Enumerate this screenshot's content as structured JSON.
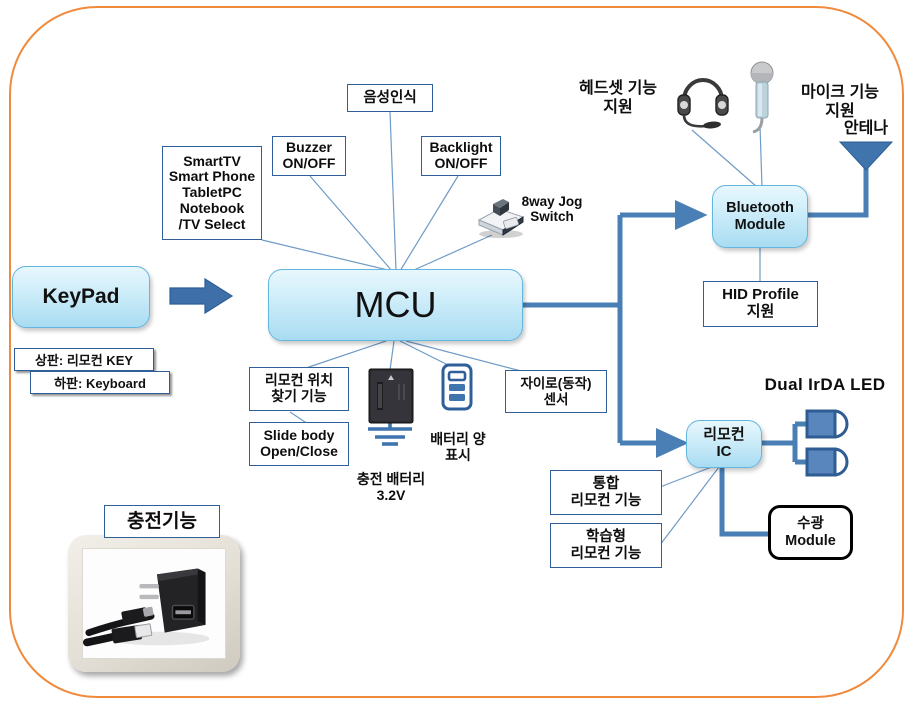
{
  "diagram": {
    "title": "Remote control / keypad system block diagram",
    "frame_color": "#f08a3c",
    "node_fill": "#bfe6f7",
    "connector_color": "#4a7fb5"
  },
  "nodes": {
    "keypad": "KeyPad",
    "mcu": "MCU",
    "bluetooth": "Bluetooth\nModule",
    "remote_ic": "리모컨\nIC",
    "receiver_module": "수광\nModule"
  },
  "keypad_labels": {
    "top": "상판: 리모컨 KEY",
    "bottom": "하판: Keyboard"
  },
  "mcu_inputs": [
    {
      "id": "device-select",
      "lines": [
        "SmartTV",
        "Smart Phone",
        "TabletPC",
        "Notebook",
        "/TV Select"
      ]
    },
    {
      "id": "buzzer",
      "lines": [
        "Buzzer",
        "ON/OFF"
      ]
    },
    {
      "id": "voice-recognition",
      "lines": [
        "음성인식"
      ]
    },
    {
      "id": "backlight",
      "lines": [
        "Backlight",
        "ON/OFF"
      ]
    }
  ],
  "mcu_outputs": [
    {
      "id": "remote-finder",
      "lines": [
        "리모컨 위치",
        "찾기 기능"
      ]
    },
    {
      "id": "slide-body",
      "lines": [
        "Slide body",
        "Open/Close"
      ]
    },
    {
      "id": "gyro-sensor",
      "lines": [
        "자이로(동작)",
        "센서"
      ]
    }
  ],
  "remote_ic_features": [
    {
      "id": "integrated-remote",
      "lines": [
        "통합",
        "리모컨 기능"
      ]
    },
    {
      "id": "learning-remote",
      "lines": [
        "학습형",
        "리모컨 기능"
      ]
    }
  ],
  "floating_labels": {
    "jog_switch": "8way Jog\nSwitch",
    "headset": "헤드셋 기능\n지원",
    "mic": "마이크 기능\n지원",
    "antenna": "안테나",
    "battery": "충전 배터리\n3.2V",
    "battery_gauge": "배터리 양\n표시",
    "dual_irda_led": "Dual  IrDA LED",
    "charging": "충전기능"
  },
  "boxes": {
    "hid_profile": "HID Profile\n지원"
  },
  "icons": {
    "headset": "headset-icon",
    "microphone": "microphone-icon",
    "antenna": "antenna-icon",
    "battery": "battery-icon",
    "battery_gauge": "battery-gauge-icon",
    "jog_switch": "jog-switch-icon",
    "ground": "ground-symbol-icon",
    "led_1": "irda-led-icon",
    "led_2": "irda-led-icon",
    "charger": "charger-photo-icon",
    "arrow_keypad_to_mcu": "arrow-right-icon"
  }
}
